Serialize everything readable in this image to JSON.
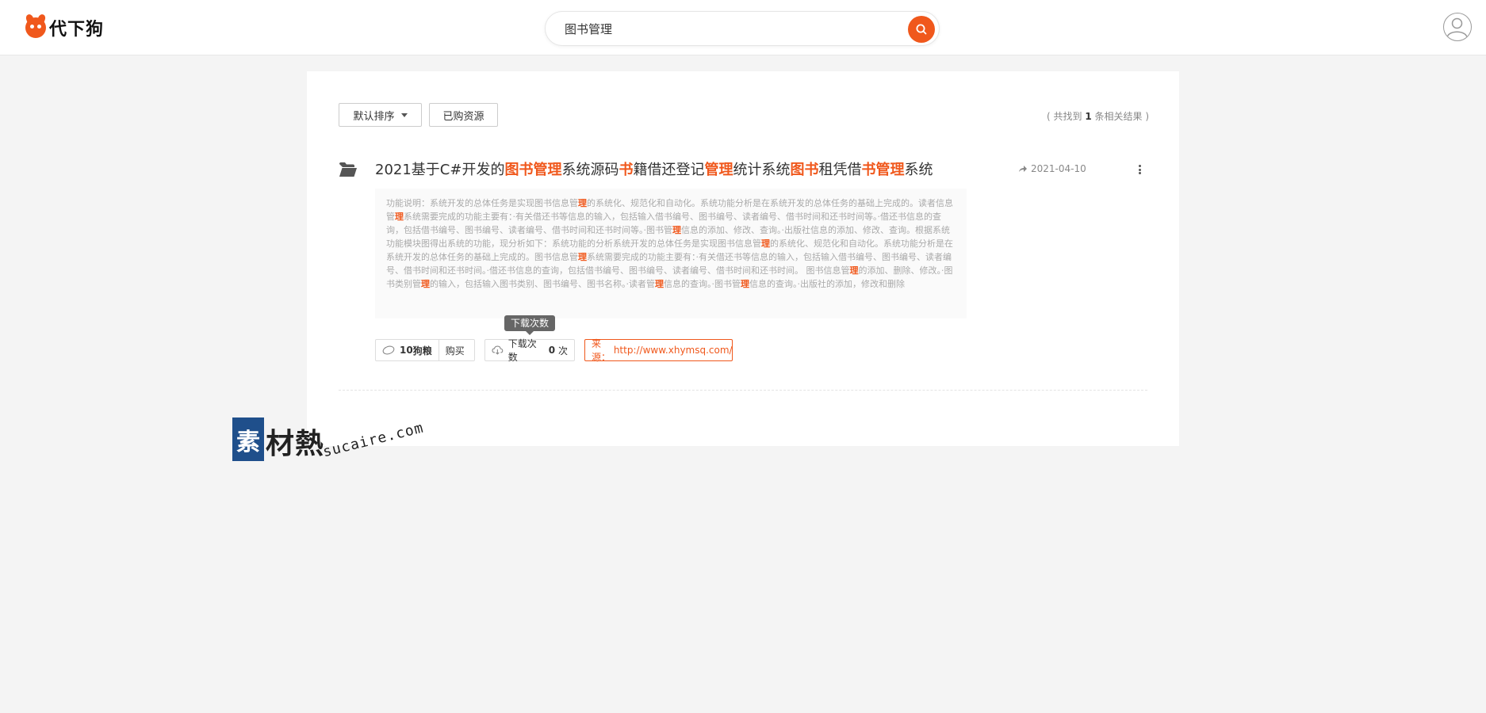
{
  "header": {
    "logo_text": "代下狗",
    "search": {
      "value": "图书管理",
      "placeholder": ""
    }
  },
  "toolbar": {
    "sort_label": "默认排序",
    "bought_label": "已购资源",
    "result_prefix": "( 共找到 ",
    "result_count": "1",
    "result_suffix": " 条相关结果 )"
  },
  "result": {
    "title_segments": [
      {
        "text": "2021基于C#开发的",
        "hl": false
      },
      {
        "text": "图书管理",
        "hl": true
      },
      {
        "text": "系统源码",
        "hl": false
      },
      {
        "text": "书",
        "hl": true
      },
      {
        "text": "籍借还登记",
        "hl": false
      },
      {
        "text": "管理",
        "hl": true
      },
      {
        "text": "统计系统",
        "hl": false
      },
      {
        "text": "图书",
        "hl": true
      },
      {
        "text": "租凭借",
        "hl": false
      },
      {
        "text": "书管理",
        "hl": true
      },
      {
        "text": "系统",
        "hl": false
      }
    ],
    "date": "2021-04-10",
    "description_segments": [
      {
        "text": "功能说明：系统开发的总体任务是实现图书信息管",
        "hl": false
      },
      {
        "text": "理",
        "hl": true
      },
      {
        "text": "的系统化、规范化和自动化。系统功能分析是在系统开发的总体任务的基础上完成的。读者信息管",
        "hl": false
      },
      {
        "text": "理",
        "hl": true
      },
      {
        "text": "系统需要完成的功能主要有：·有关借还书等信息的输入，包括输入借书编号、图书编号、读者编号、借书时间和还书时间等。·借还书信息的查询，包括借书编号、图书编号、读者编号、借书时间和还书时间等。·图书管",
        "hl": false
      },
      {
        "text": "理",
        "hl": true
      },
      {
        "text": "信息的添加、修改、查询。·出版社信息的添加、修改、查询。根据系统功能模块图得出系统的功能，现分析如下：系统功能的分析系统开发的总体任务是实现图书信息管",
        "hl": false
      },
      {
        "text": "理",
        "hl": true
      },
      {
        "text": "的系统化、规范化和自动化。系统功能分析是在系统开发的总体任务的基础上完成的。图书信息管",
        "hl": false
      },
      {
        "text": "理",
        "hl": true
      },
      {
        "text": "系统需要完成的功能主要有：·有关借还书等信息的输入，包括输入借书编号、图书编号、读者编号、借书时间和还书时间。·借还书信息的查询，包括借书编号、图书编号、读者编号、借书时间和还书时间。 图书信息管",
        "hl": false
      },
      {
        "text": "理",
        "hl": true
      },
      {
        "text": "的添加、删除、修改。·图书类别管",
        "hl": false
      },
      {
        "text": "理",
        "hl": true
      },
      {
        "text": "的输入，包括输入图书类别、图书编号、图书名称。·读者管",
        "hl": false
      },
      {
        "text": "理",
        "hl": true
      },
      {
        "text": "信息的查询。·图书管",
        "hl": false
      },
      {
        "text": "理",
        "hl": true
      },
      {
        "text": "信息的查询。·出版社的添加，修改和删除",
        "hl": false
      }
    ],
    "tooltip": "下载次数",
    "price_amount": "10",
    "price_unit": " 狗粮",
    "buy_label": "购买",
    "download_label": "下载次数",
    "download_count": "0",
    "download_unit": "次",
    "source_label": "来源：",
    "source_url": "http://www.xhymsq.com/"
  },
  "watermark": {
    "chars": "素材熱",
    "block_char": "素",
    "rest_chars": "材熱",
    "url": "sucaire.com"
  },
  "colors": {
    "accent": "#f0581c",
    "background": "#f4f4f4",
    "watermark_blue": "#1f4f8b"
  }
}
